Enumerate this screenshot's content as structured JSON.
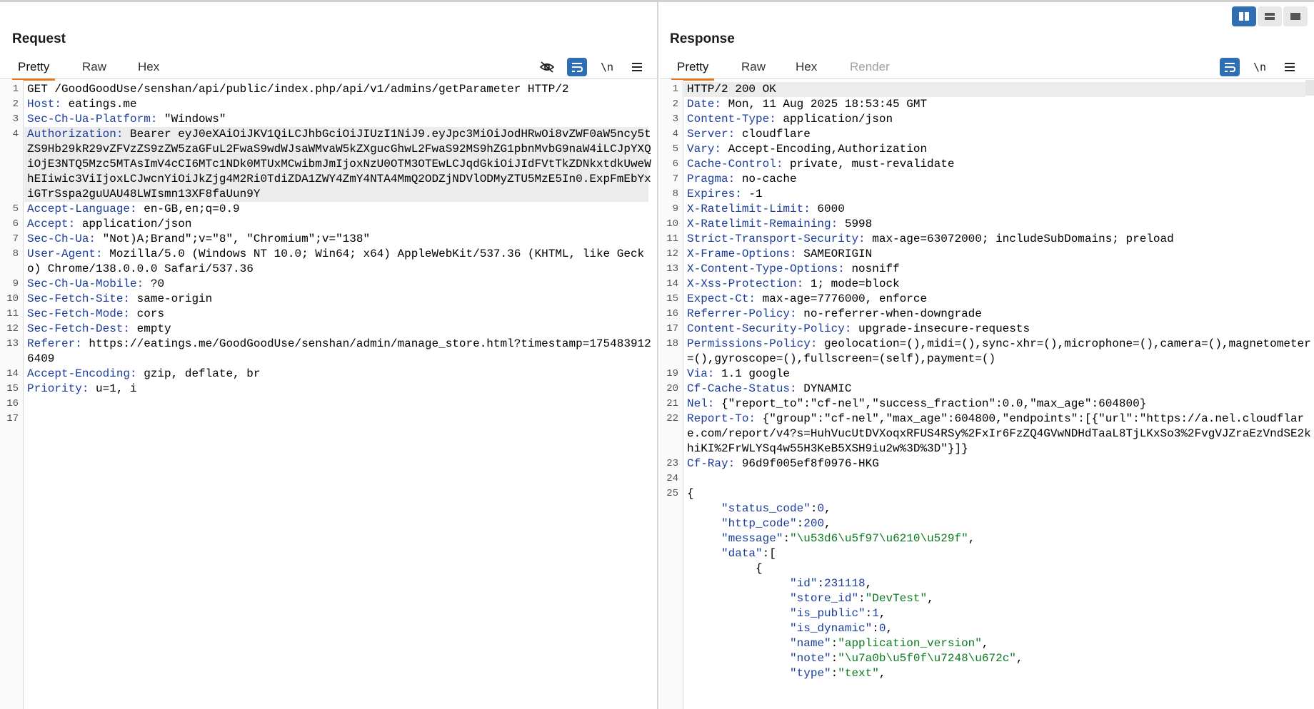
{
  "layout_toggle": {
    "modes": [
      "side-by-side-icon",
      "stacked-icon",
      "single-icon"
    ],
    "active": 0
  },
  "request": {
    "title": "Request",
    "tabs": [
      "Pretty",
      "Raw",
      "Hex"
    ],
    "active_tab": "Pretty",
    "tools": {
      "newline": "\\n"
    },
    "lines": [
      {
        "n": "1",
        "text": "GET /GoodGoodUse/senshan/api/public/index.php/api/v1/admins/getParameter HTTP/2"
      },
      {
        "n": "2",
        "key": "Host:",
        "val": " eatings.me"
      },
      {
        "n": "3",
        "key": "Sec-Ch-Ua-Platform:",
        "val": " \"Windows\""
      },
      {
        "n": "4",
        "key": "Authorization:",
        "val": " Bearer eyJ0eXAiOiJKV1QiLCJhbGciOiJIUzI1NiJ9.eyJpc3MiOiJodHRwOi8vZWF0aW5ncy5tZS9Hb29kR29vZFVzZS9zZW5zaGFuL2FwaS9wdWJsaWMvaW5kZXgucGhwL2FwaS92MS9hZG1pbnMvbG9naW4iLCJpYXQiOjE3NTQ5Mzc5MTAsImV4cCI6MTc1NDk0MTUxMCwibmJmIjoxNzU0OTM3OTEwLCJqdGkiOiJIdFVtTkZDNkxtdkUweWhEIiwic3ViIjoxLCJwcnYiOiJkZjg4M2Ri0TdiZDA1ZWY4ZmY4NTA4MmQ2ODZjNDVlODMyZTU5MzE5In0.ExpFmEbYxiGTrSspa2guUAU48LWIsmn13XF8faUun9Y"
      },
      {
        "n": "5",
        "key": "Accept-Language:",
        "val": " en-GB,en;q=0.9"
      },
      {
        "n": "6",
        "key": "Accept:",
        "val": " application/json"
      },
      {
        "n": "7",
        "key": "Sec-Ch-Ua:",
        "val": " \"Not)A;Brand\";v=\"8\", \"Chromium\";v=\"138\""
      },
      {
        "n": "8",
        "key": "User-Agent:",
        "val": " Mozilla/5.0 (Windows NT 10.0; Win64; x64) AppleWebKit/537.36 (KHTML, like Gecko) Chrome/138.0.0.0 Safari/537.36"
      },
      {
        "n": "9",
        "key": "Sec-Ch-Ua-Mobile:",
        "val": " ?0"
      },
      {
        "n": "10",
        "key": "Sec-Fetch-Site:",
        "val": " same-origin"
      },
      {
        "n": "11",
        "key": "Sec-Fetch-Mode:",
        "val": " cors"
      },
      {
        "n": "12",
        "key": "Sec-Fetch-Dest:",
        "val": " empty"
      },
      {
        "n": "13",
        "key": "Referer:",
        "val": " https://eatings.me/GoodGoodUse/senshan/admin/manage_store.html?timestamp=1754839126409"
      },
      {
        "n": "14",
        "key": "Accept-Encoding:",
        "val": " gzip, deflate, br"
      },
      {
        "n": "15",
        "key": "Priority:",
        "val": " u=1, i"
      },
      {
        "n": "16",
        "text": ""
      },
      {
        "n": "17",
        "text": ""
      }
    ]
  },
  "response": {
    "title": "Response",
    "tabs": [
      "Pretty",
      "Raw",
      "Hex",
      "Render"
    ],
    "active_tab": "Pretty",
    "tools": {
      "newline": "\\n"
    },
    "lines": [
      {
        "n": "1",
        "text": "HTTP/2 200 OK"
      },
      {
        "n": "2",
        "key": "Date:",
        "val": " Mon, 11 Aug 2025 18:53:45 GMT"
      },
      {
        "n": "3",
        "key": "Content-Type:",
        "val": " application/json"
      },
      {
        "n": "4",
        "key": "Server:",
        "val": " cloudflare"
      },
      {
        "n": "5",
        "key": "Vary:",
        "val": " Accept-Encoding,Authorization"
      },
      {
        "n": "6",
        "key": "Cache-Control:",
        "val": " private, must-revalidate"
      },
      {
        "n": "7",
        "key": "Pragma:",
        "val": " no-cache"
      },
      {
        "n": "8",
        "key": "Expires:",
        "val": " -1"
      },
      {
        "n": "9",
        "key": "X-Ratelimit-Limit:",
        "val": " 6000"
      },
      {
        "n": "10",
        "key": "X-Ratelimit-Remaining:",
        "val": " 5998"
      },
      {
        "n": "11",
        "key": "Strict-Transport-Security:",
        "val": " max-age=63072000; includeSubDomains; preload"
      },
      {
        "n": "12",
        "key": "X-Frame-Options:",
        "val": " SAMEORIGIN"
      },
      {
        "n": "13",
        "key": "X-Content-Type-Options:",
        "val": " nosniff"
      },
      {
        "n": "14",
        "key": "X-Xss-Protection:",
        "val": " 1; mode=block"
      },
      {
        "n": "15",
        "key": "Expect-Ct:",
        "val": " max-age=7776000, enforce"
      },
      {
        "n": "16",
        "key": "Referrer-Policy:",
        "val": " no-referrer-when-downgrade"
      },
      {
        "n": "17",
        "key": "Content-Security-Policy:",
        "val": " upgrade-insecure-requests"
      },
      {
        "n": "18",
        "key": "Permissions-Policy:",
        "val": " geolocation=(),midi=(),sync-xhr=(),microphone=(),camera=(),magnetometer=(),gyroscope=(),fullscreen=(self),payment=()"
      },
      {
        "n": "19",
        "key": "Via:",
        "val": " 1.1 google"
      },
      {
        "n": "20",
        "key": "Cf-Cache-Status:",
        "val": " DYNAMIC"
      },
      {
        "n": "21",
        "key": "Nel:",
        "val": " {\"report_to\":\"cf-nel\",\"success_fraction\":0.0,\"max_age\":604800}"
      },
      {
        "n": "22",
        "key": "Report-To:",
        "val": " {\"group\":\"cf-nel\",\"max_age\":604800,\"endpoints\":[{\"url\":\"https://a.nel.cloudflare.com/report/v4?s=HuhVucUtDVXoqxRFUS4RSy%2FxIr6FzZQ4GVwNDHdTaaL8TjLKxSo3%2FvgVJZraEzVndSE2khiKI%2FrWLYSq4w55H3KeB5XSH9iu2w%3D%3D\"}]}"
      },
      {
        "n": "23",
        "key": "Cf-Ray:",
        "val": " 96d9f005ef8f0976-HKG"
      },
      {
        "n": "24",
        "text": ""
      },
      {
        "n": "25",
        "text": "{"
      },
      {
        "n": "",
        "indent": "     ",
        "jk": "\"status_code\"",
        "jv": "0",
        "jt": "n",
        "tail": ","
      },
      {
        "n": "",
        "indent": "     ",
        "jk": "\"http_code\"",
        "jv": "200",
        "jt": "n",
        "tail": ","
      },
      {
        "n": "",
        "indent": "     ",
        "jk": "\"message\"",
        "jv": "\"\\u53d6\\u5f97\\u6210\\u529f\"",
        "jt": "s",
        "tail": ","
      },
      {
        "n": "",
        "indent": "     ",
        "jk": "\"data\"",
        "jv": "[",
        "jt": "p",
        "tail": ""
      },
      {
        "n": "",
        "text": "          {"
      },
      {
        "n": "",
        "indent": "               ",
        "jk": "\"id\"",
        "jv": "231118",
        "jt": "n",
        "tail": ","
      },
      {
        "n": "",
        "indent": "               ",
        "jk": "\"store_id\"",
        "jv": "\"DevTest\"",
        "jt": "s",
        "tail": ","
      },
      {
        "n": "",
        "indent": "               ",
        "jk": "\"is_public\"",
        "jv": "1",
        "jt": "n",
        "tail": ","
      },
      {
        "n": "",
        "indent": "               ",
        "jk": "\"is_dynamic\"",
        "jv": "0",
        "jt": "n",
        "tail": ","
      },
      {
        "n": "",
        "indent": "               ",
        "jk": "\"name\"",
        "jv": "\"application_version\"",
        "jt": "s",
        "tail": ","
      },
      {
        "n": "",
        "indent": "               ",
        "jk": "\"note\"",
        "jv": "\"\\u7a0b\\u5f0f\\u7248\\u672c\"",
        "jt": "s",
        "tail": ","
      },
      {
        "n": "",
        "indent": "               ",
        "jk": "\"type\"",
        "jv": "\"text\"",
        "jt": "s",
        "tail": ","
      }
    ]
  }
}
